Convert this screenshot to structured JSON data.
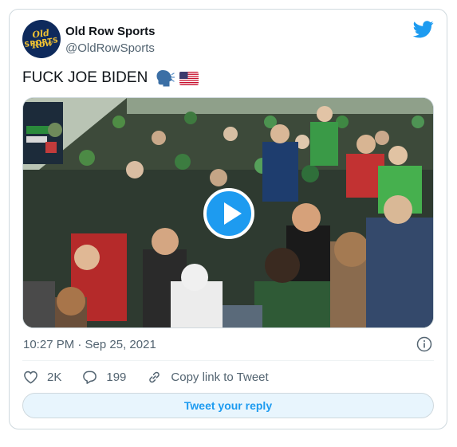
{
  "author": {
    "display_name": "Old Row Sports",
    "handle": "@OldRowSports",
    "avatar_line1": "Old Row",
    "avatar_line2": "SPORTS"
  },
  "tweet": {
    "text": "FUCK JOE BIDEN",
    "emojis": [
      "speaking-head-icon",
      "us-flag-icon"
    ],
    "timestamp": "10:27 PM · Sep 25, 2021"
  },
  "actions": {
    "likes": "2K",
    "replies": "199",
    "copy_link": "Copy link to Tweet"
  },
  "reply_button": "Tweet your reply",
  "colors": {
    "accent": "#1d9bf0",
    "muted_text": "#536471",
    "border": "#cfd9de",
    "reply_bg": "#e8f5fd"
  }
}
